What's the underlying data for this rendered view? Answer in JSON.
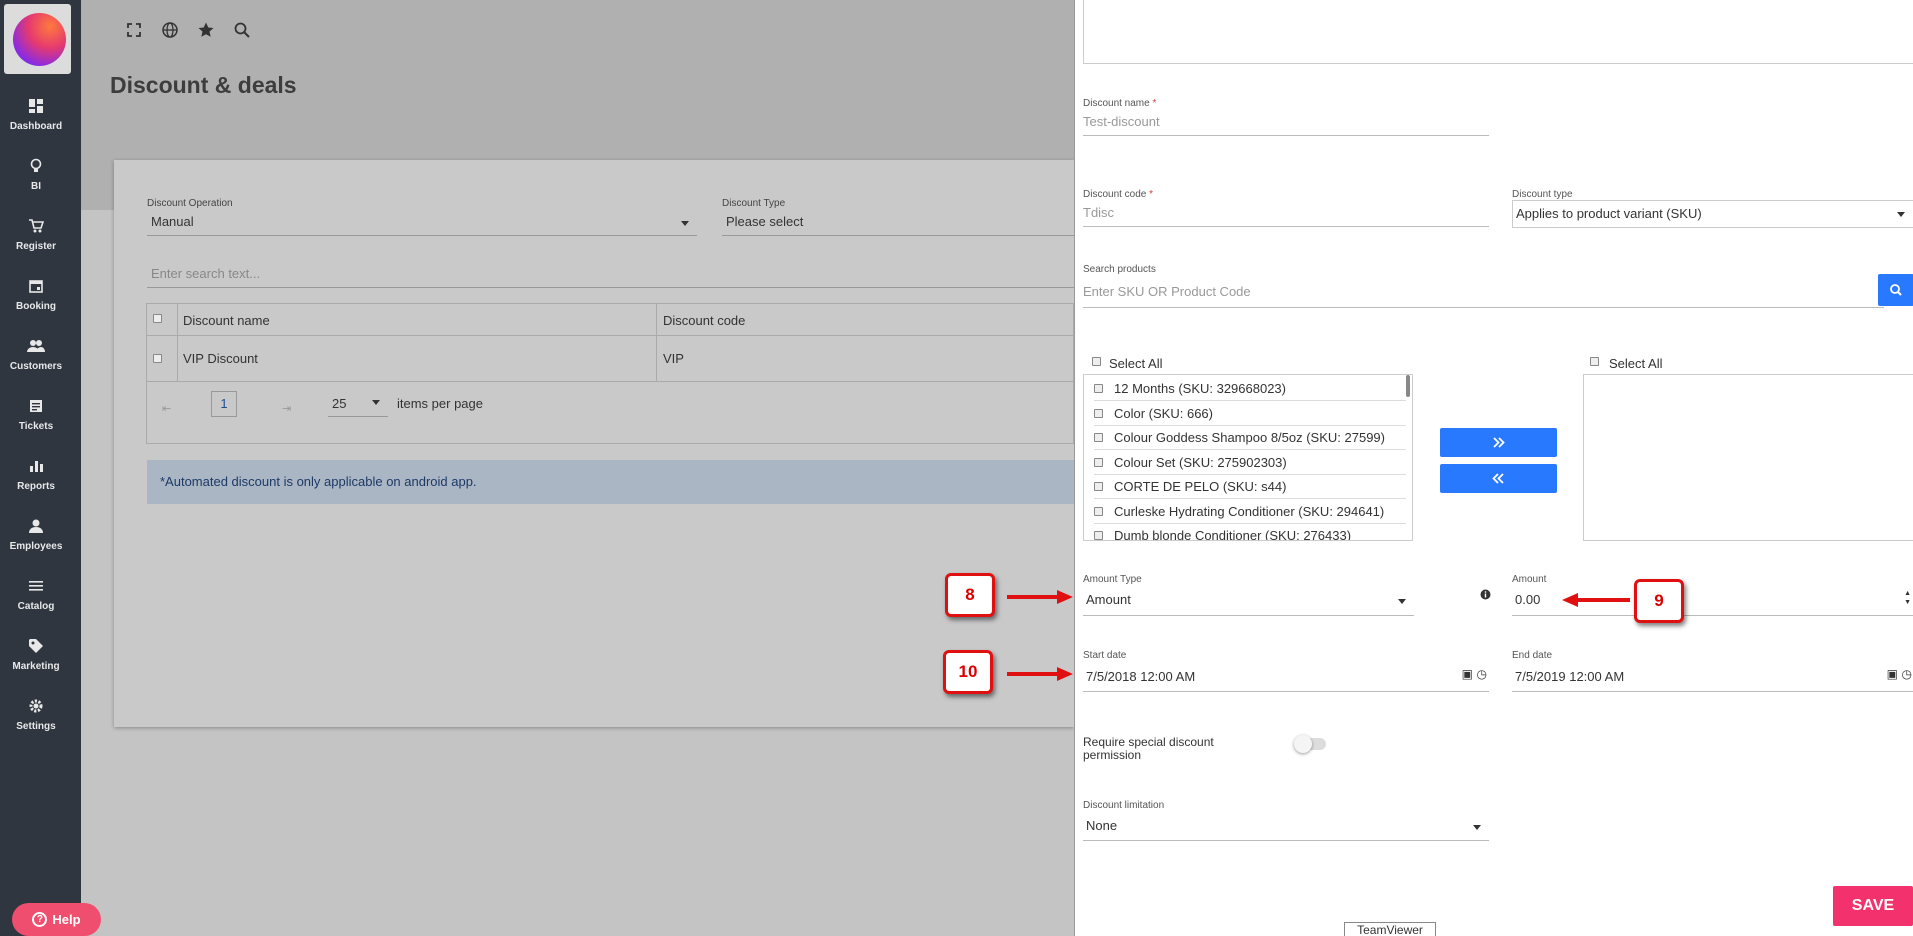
{
  "sidebar": {
    "items": [
      {
        "label": "Dashboard",
        "icon": "dashboard-icon"
      },
      {
        "label": "BI",
        "icon": "lightbulb-icon"
      },
      {
        "label": "Register",
        "icon": "cart-icon"
      },
      {
        "label": "Booking",
        "icon": "calendar-icon"
      },
      {
        "label": "Customers",
        "icon": "people-icon"
      },
      {
        "label": "Tickets",
        "icon": "ticket-icon"
      },
      {
        "label": "Reports",
        "icon": "bar-chart-icon"
      },
      {
        "label": "Employees",
        "icon": "person-icon"
      },
      {
        "label": "Catalog",
        "icon": "list-icon"
      },
      {
        "label": "Marketing",
        "icon": "tag-icon"
      },
      {
        "label": "Settings",
        "icon": "gear-icon"
      }
    ],
    "help_label": "Help"
  },
  "page": {
    "title": "Discount & deals"
  },
  "filters": {
    "operation_label": "Discount Operation",
    "operation_value": "Manual",
    "type_label": "Discount Type",
    "type_value": "Please select",
    "search_placeholder": "Enter search text..."
  },
  "table": {
    "headers": [
      "Discount name",
      "Discount code"
    ],
    "rows": [
      {
        "name": "VIP Discount",
        "code": "VIP"
      }
    ]
  },
  "pagination": {
    "page": "1",
    "page_size": "25",
    "per_page_label": "items per page"
  },
  "info_message": "*Automated discount is only applicable on android app.",
  "form": {
    "name_label": "Discount name",
    "name_value": "Test-discount",
    "code_label": "Discount code",
    "code_value": "Tdisc",
    "type_label": "Discount type",
    "type_value": "Applies to product variant (SKU)",
    "search_label": "Search products",
    "search_placeholder": "Enter SKU OR Product Code",
    "select_all_left": "Select All",
    "select_all_right": "Select All",
    "products": [
      "12 Months (SKU: 329668023)",
      "Color (SKU: 666)",
      "Colour Goddess Shampoo 8/5oz (SKU: 27599)",
      "Colour Set (SKU: 275902303)",
      "CORTE DE PELO (SKU: s44)",
      "Curleske Hydrating Conditioner (SKU: 294641)",
      "Dumb blonde Conditioner (SKU: 276433)"
    ],
    "amount_type_label": "Amount Type",
    "amount_type_value": "Amount",
    "amount_label": "Amount",
    "amount_value": "0.00",
    "start_label": "Start date",
    "start_value": "7/5/2018 12:00 AM",
    "end_label": "End date",
    "end_value": "7/5/2019 12:00 AM",
    "permission_label": "Require special discount permission",
    "limitation_label": "Discount limitation",
    "limitation_value": "None",
    "save_label": "SAVE"
  },
  "annotations": [
    "8",
    "9",
    "10"
  ],
  "teamviewer_label": "TeamViewer",
  "colors": {
    "accent_blue": "#2979ff",
    "save_pink": "#f2316d",
    "annotation_red": "#e01010",
    "sidebar": "#2f3640"
  }
}
